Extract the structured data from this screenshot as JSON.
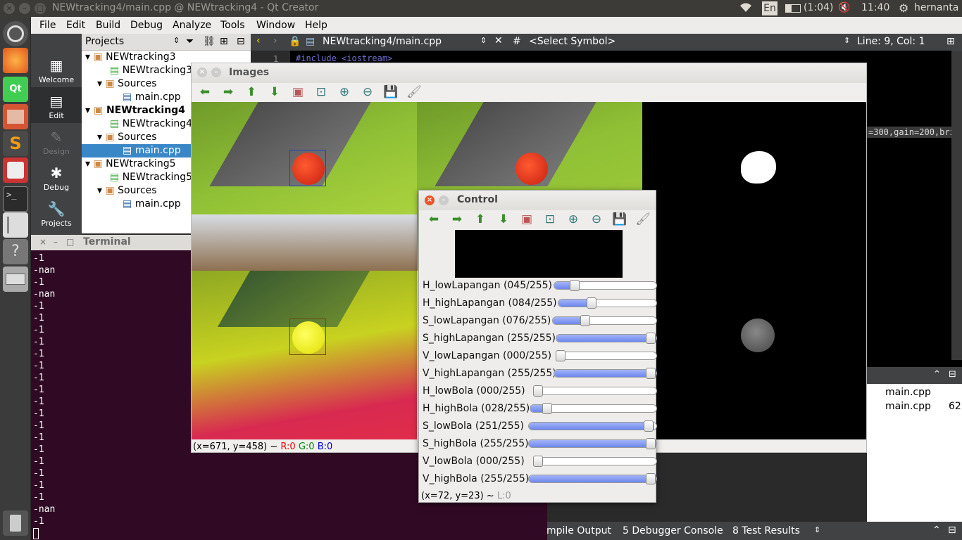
{
  "top_panel": {
    "close": "×",
    "minimize": "–",
    "maximize": "□",
    "title": "NEWtracking4/main.cpp @ NEWtracking4 - Qt Creator",
    "lang": "En",
    "battery": "(1:04)",
    "time": "11:40",
    "user": "hernanta"
  },
  "launcher": {
    "items": [
      "ubuntu-logo-icon",
      "firefox-icon",
      "qt-icon",
      "files-icon",
      "sublime-icon",
      "document-viewer-icon",
      "terminal-icon",
      "text-editor-icon",
      "help-icon",
      "disk-icon",
      "trash-icon"
    ]
  },
  "menubar": {
    "items": [
      "File",
      "Edit",
      "Build",
      "Debug",
      "Analyze",
      "Tools",
      "Window",
      "Help"
    ]
  },
  "modes": [
    "Welcome",
    "Edit",
    "Design",
    "Debug",
    "Projects"
  ],
  "projects": {
    "header": "Projects",
    "tree": [
      {
        "label": "NEWtracking3",
        "bold": false
      },
      {
        "label": "NEWtracking3",
        "bold": false
      },
      {
        "label": "Sources",
        "bold": false
      },
      {
        "label": "main.cpp",
        "bold": false
      },
      {
        "label": "NEWtracking4",
        "bold": true
      },
      {
        "label": "NEWtracking4",
        "bold": false
      },
      {
        "label": "Sources",
        "bold": false
      },
      {
        "label": "main.cpp",
        "bold": false,
        "selected": true
      },
      {
        "label": "NEWtracking5",
        "bold": false
      },
      {
        "label": "NEWtracking5",
        "bold": false
      },
      {
        "label": "Sources",
        "bold": false
      },
      {
        "label": "main.cpp",
        "bold": false
      }
    ]
  },
  "editor": {
    "file": "NEWtracking4/main.cpp",
    "symbol_hash": "#",
    "symbol": "<Select Symbol>",
    "position": "Line: 9, Col: 1",
    "line_no": "1",
    "code_line": "#include <iostream>",
    "snippet": "=300,gain=200,bri"
  },
  "right_panel": {
    "rows": [
      {
        "file": "main.cpp",
        "num": ""
      },
      {
        "file": "main.cpp",
        "num": "62"
      }
    ]
  },
  "bottom_bar": {
    "compile": "mpile Output",
    "debugger": "5  Debugger Console",
    "tests": "8  Test Results"
  },
  "terminal": {
    "title": "Terminal",
    "lines": [
      "-1",
      "-nan",
      "-1",
      "-nan",
      "-1",
      "-1",
      "-1",
      "-1",
      "-1",
      "-1",
      "-1",
      "-1",
      "-1",
      "-1",
      "-1",
      "-1",
      "-1",
      "-1",
      "-1",
      "-1",
      "-1",
      "-nan",
      "-1"
    ]
  },
  "images_window": {
    "title": "Images",
    "status_prefix": "(x=671, y=458) ~ ",
    "status_r": "R:0",
    "status_g": "G:0",
    "status_b": "B:0"
  },
  "control_window": {
    "title": "Control",
    "status": "(x=72, y=23) ~ ",
    "status_l": "L:0",
    "sliders": [
      {
        "label": "H_lowLapangan (045/255)",
        "value": 45
      },
      {
        "label": "H_highLapangan (084/255)",
        "value": 84
      },
      {
        "label": "S_lowLapangan (076/255)",
        "value": 76
      },
      {
        "label": "S_highLapangan (255/255)",
        "value": 255
      },
      {
        "label": "V_lowLapangan (000/255)",
        "value": 0
      },
      {
        "label": "V_highLapangan (255/255)",
        "value": 255
      },
      {
        "label": "H_lowBola  (000/255)",
        "value": 0
      },
      {
        "label": "H_highBola (028/255)",
        "value": 28
      },
      {
        "label": "S_lowBola  (251/255)",
        "value": 251
      },
      {
        "label": "S_highBola (255/255)",
        "value": 255
      },
      {
        "label": "V_lowBola  (000/255)",
        "value": 0
      },
      {
        "label": "V_highBola (255/255)",
        "value": 255
      }
    ]
  },
  "toolbar_icons": [
    "arrow-left-icon",
    "arrow-right-icon",
    "arrow-up-icon",
    "arrow-down-icon",
    "image-icon",
    "zoom-fit-icon",
    "zoom-in-icon",
    "zoom-out-icon",
    "save-icon",
    "brush-icon"
  ]
}
